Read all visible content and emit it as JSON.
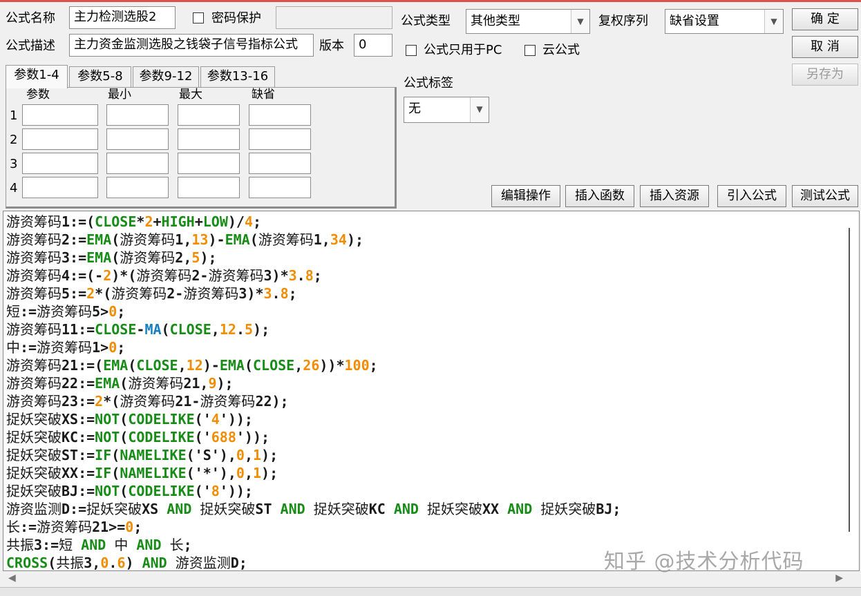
{
  "header": {
    "name_label": "公式名称",
    "name_value": "主力检测选股2",
    "password_label": "密码保护",
    "desc_label": "公式描述",
    "desc_value": "主力资金监测选股之钱袋子信号指标公式",
    "version_label": "版本",
    "version_value": "0",
    "type_label": "公式类型",
    "type_value": "其他类型",
    "rights_label": "复权序列",
    "rights_value": "缺省设置",
    "pc_only_label": "公式只用于PC",
    "cloud_label": "云公式",
    "tag_label": "公式标签",
    "tag_value": "无"
  },
  "buttons": {
    "ok": "确  定",
    "cancel": "取  消",
    "save_as": "另存为",
    "edit_ops": "编辑操作",
    "insert_func": "插入函数",
    "insert_res": "插入资源",
    "import_formula": "引入公式",
    "test_formula": "测试公式"
  },
  "params": {
    "tabs": [
      "参数1-4",
      "参数5-8",
      "参数9-12",
      "参数13-16"
    ],
    "columns": [
      "参数",
      "最小",
      "最大",
      "缺省"
    ],
    "rows": [
      "1",
      "2",
      "3",
      "4"
    ]
  },
  "code_lines": [
    [
      [
        "游资筹码",
        "var"
      ],
      [
        "1:=(",
        ""
      ],
      [
        "CLOSE",
        "fn"
      ],
      [
        "*",
        ""
      ],
      [
        "2",
        "num"
      ],
      [
        "+",
        ""
      ],
      [
        "HIGH",
        "fn"
      ],
      [
        "+",
        ""
      ],
      [
        "LOW",
        "fn"
      ],
      [
        ")/",
        ""
      ],
      [
        "4",
        "num"
      ],
      [
        ";",
        ""
      ]
    ],
    [
      [
        "游资筹码",
        "var"
      ],
      [
        "2:=",
        ""
      ],
      [
        "EMA",
        "fn"
      ],
      [
        "(",
        ""
      ],
      [
        "游资筹码",
        "var"
      ],
      [
        "1,",
        ""
      ],
      [
        "13",
        "num"
      ],
      [
        ")-",
        ""
      ],
      [
        "EMA",
        "fn"
      ],
      [
        "(",
        ""
      ],
      [
        "游资筹码",
        "var"
      ],
      [
        "1,",
        ""
      ],
      [
        "34",
        "num"
      ],
      [
        ");",
        ""
      ]
    ],
    [
      [
        "游资筹码",
        "var"
      ],
      [
        "3:=",
        ""
      ],
      [
        "EMA",
        "fn"
      ],
      [
        "(",
        ""
      ],
      [
        "游资筹码",
        "var"
      ],
      [
        "2,",
        ""
      ],
      [
        "5",
        "num"
      ],
      [
        ");",
        ""
      ]
    ],
    [
      [
        "游资筹码",
        "var"
      ],
      [
        "4:=(-",
        ""
      ],
      [
        "2",
        "num"
      ],
      [
        ")*(",
        ""
      ],
      [
        "游资筹码",
        "var"
      ],
      [
        "2-",
        ""
      ],
      [
        "游资筹码",
        "var"
      ],
      [
        "3)*",
        ""
      ],
      [
        "3",
        "num"
      ],
      [
        ".",
        ""
      ],
      [
        "8",
        "num"
      ],
      [
        ";",
        ""
      ]
    ],
    [
      [
        "游资筹码",
        "var"
      ],
      [
        "5:=",
        ""
      ],
      [
        "2",
        "num"
      ],
      [
        "*(",
        ""
      ],
      [
        "游资筹码",
        "var"
      ],
      [
        "2-",
        ""
      ],
      [
        "游资筹码",
        "var"
      ],
      [
        "3)*",
        ""
      ],
      [
        "3",
        "num"
      ],
      [
        ".",
        ""
      ],
      [
        "8",
        "num"
      ],
      [
        ";",
        ""
      ]
    ],
    [
      [
        "短",
        "var"
      ],
      [
        ":=",
        ""
      ],
      [
        "游资筹码",
        "var"
      ],
      [
        "5>",
        ""
      ],
      [
        "0",
        "num"
      ],
      [
        ";",
        ""
      ]
    ],
    [
      [
        "游资筹码",
        "var"
      ],
      [
        "11:=",
        ""
      ],
      [
        "CLOSE",
        "fn"
      ],
      [
        "-",
        ""
      ],
      [
        "MA",
        "fnb"
      ],
      [
        "(",
        ""
      ],
      [
        "CLOSE",
        "fn"
      ],
      [
        ",",
        ""
      ],
      [
        "12",
        "num"
      ],
      [
        ".",
        ""
      ],
      [
        "5",
        "num"
      ],
      [
        ");",
        ""
      ]
    ],
    [
      [
        "中",
        "var"
      ],
      [
        ":=",
        ""
      ],
      [
        "游资筹码",
        "var"
      ],
      [
        "1>",
        ""
      ],
      [
        "0",
        "num"
      ],
      [
        ";",
        ""
      ]
    ],
    [
      [
        "游资筹码",
        "var"
      ],
      [
        "21:=(",
        ""
      ],
      [
        "EMA",
        "fn"
      ],
      [
        "(",
        ""
      ],
      [
        "CLOSE",
        "fn"
      ],
      [
        ",",
        ""
      ],
      [
        "12",
        "num"
      ],
      [
        ")-",
        ""
      ],
      [
        "EMA",
        "fn"
      ],
      [
        "(",
        ""
      ],
      [
        "CLOSE",
        "fn"
      ],
      [
        ",",
        ""
      ],
      [
        "26",
        "num"
      ],
      [
        "))*",
        ""
      ],
      [
        "100",
        "num"
      ],
      [
        ";",
        ""
      ]
    ],
    [
      [
        "游资筹码",
        "var"
      ],
      [
        "22:=",
        ""
      ],
      [
        "EMA",
        "fn"
      ],
      [
        "(",
        ""
      ],
      [
        "游资筹码",
        "var"
      ],
      [
        "21,",
        ""
      ],
      [
        "9",
        "num"
      ],
      [
        ");",
        ""
      ]
    ],
    [
      [
        "游资筹码",
        "var"
      ],
      [
        "23:=",
        ""
      ],
      [
        "2",
        "num"
      ],
      [
        "*(",
        ""
      ],
      [
        "游资筹码",
        "var"
      ],
      [
        "21-",
        ""
      ],
      [
        "游资筹码",
        "var"
      ],
      [
        "22);",
        ""
      ]
    ],
    [
      [
        "捉妖突破",
        "var"
      ],
      [
        "XS:=",
        ""
      ],
      [
        "NOT",
        "fn"
      ],
      [
        "(",
        ""
      ],
      [
        "CODELIKE",
        "fn"
      ],
      [
        "('",
        ""
      ],
      [
        "4",
        "num"
      ],
      [
        "'));",
        ""
      ]
    ],
    [
      [
        "捉妖突破",
        "var"
      ],
      [
        "KC:=",
        ""
      ],
      [
        "NOT",
        "fn"
      ],
      [
        "(",
        ""
      ],
      [
        "CODELIKE",
        "fn"
      ],
      [
        "('",
        ""
      ],
      [
        "688",
        "num"
      ],
      [
        "'));",
        ""
      ]
    ],
    [
      [
        "捉妖突破",
        "var"
      ],
      [
        "ST:=",
        ""
      ],
      [
        "IF",
        "fn"
      ],
      [
        "(",
        ""
      ],
      [
        "NAMELIKE",
        "fn"
      ],
      [
        "('S'),",
        ""
      ],
      [
        "0",
        "num"
      ],
      [
        ",",
        ""
      ],
      [
        "1",
        "num"
      ],
      [
        ");",
        ""
      ]
    ],
    [
      [
        "捉妖突破",
        "var"
      ],
      [
        "XX:=",
        ""
      ],
      [
        "IF",
        "fn"
      ],
      [
        "(",
        ""
      ],
      [
        "NAMELIKE",
        "fn"
      ],
      [
        "('*'),",
        ""
      ],
      [
        "0",
        "num"
      ],
      [
        ",",
        ""
      ],
      [
        "1",
        "num"
      ],
      [
        ");",
        ""
      ]
    ],
    [
      [
        "捉妖突破",
        "var"
      ],
      [
        "BJ:=",
        ""
      ],
      [
        "NOT",
        "fn"
      ],
      [
        "(",
        ""
      ],
      [
        "CODELIKE",
        "fn"
      ],
      [
        "('",
        ""
      ],
      [
        "8",
        "num"
      ],
      [
        "'));",
        ""
      ]
    ],
    [
      [
        "游资监测",
        "var"
      ],
      [
        "D:=",
        ""
      ],
      [
        "捉妖突破",
        "var"
      ],
      [
        "XS ",
        ""
      ],
      [
        "AND",
        "and"
      ],
      [
        " ",
        ""
      ],
      [
        "捉妖突破",
        "var"
      ],
      [
        "ST ",
        ""
      ],
      [
        "AND",
        "and"
      ],
      [
        " ",
        ""
      ],
      [
        "捉妖突破",
        "var"
      ],
      [
        "KC ",
        ""
      ],
      [
        "AND",
        "and"
      ],
      [
        " ",
        ""
      ],
      [
        "捉妖突破",
        "var"
      ],
      [
        "XX ",
        ""
      ],
      [
        "AND",
        "and"
      ],
      [
        " ",
        ""
      ],
      [
        "捉妖突破",
        "var"
      ],
      [
        "BJ;",
        ""
      ]
    ],
    [
      [
        "长",
        "var"
      ],
      [
        ":=",
        ""
      ],
      [
        "游资筹码",
        "var"
      ],
      [
        "21>=",
        ""
      ],
      [
        "0",
        "num"
      ],
      [
        ";",
        ""
      ]
    ],
    [
      [
        "共振",
        "var"
      ],
      [
        "3:=",
        ""
      ],
      [
        "短",
        "var"
      ],
      [
        " ",
        ""
      ],
      [
        "AND",
        "and"
      ],
      [
        " ",
        ""
      ],
      [
        "中",
        "var"
      ],
      [
        " ",
        ""
      ],
      [
        "AND",
        "and"
      ],
      [
        " ",
        ""
      ],
      [
        "长",
        "var"
      ],
      [
        ";",
        ""
      ]
    ],
    [
      [
        "CROSS",
        "fn"
      ],
      [
        "(",
        ""
      ],
      [
        "共振",
        "var"
      ],
      [
        "3,",
        ""
      ],
      [
        "0",
        "num"
      ],
      [
        ".",
        ""
      ],
      [
        "6",
        "num"
      ],
      [
        ") ",
        ""
      ],
      [
        "AND",
        "and"
      ],
      [
        " ",
        ""
      ],
      [
        "游资监测",
        "var"
      ],
      [
        "D;",
        ""
      ]
    ]
  ],
  "watermark": "知乎 @技术分析代码"
}
